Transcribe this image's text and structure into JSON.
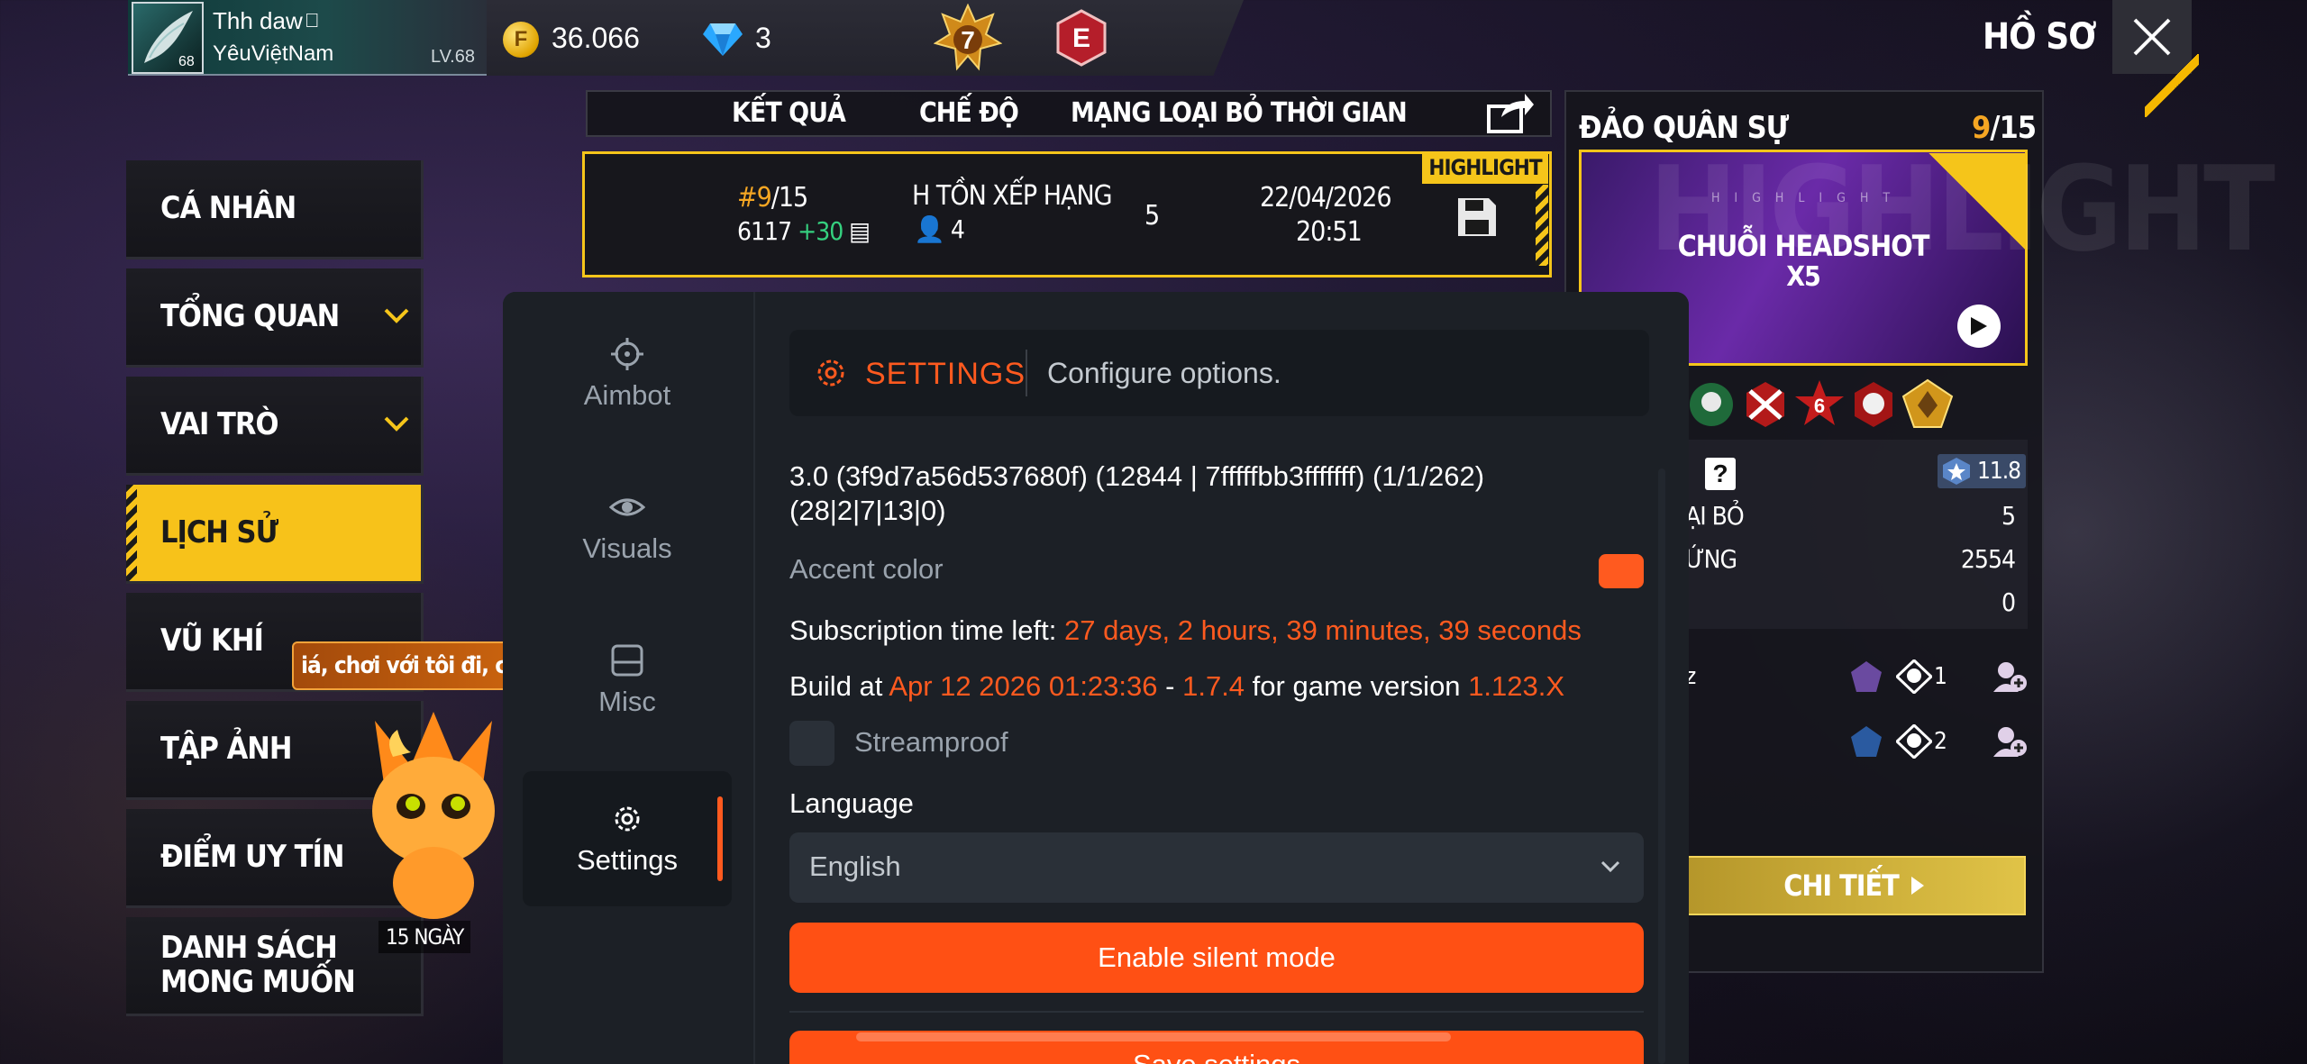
{
  "profile": {
    "name": "Thh daw",
    "tag": "YêuViệtNam",
    "avatar_level": "68",
    "level": "LV.68"
  },
  "currency": {
    "coins": "36.066",
    "coin_symbol": "F",
    "diamonds": "3"
  },
  "rank_badge_number": "7",
  "elite_badge_letter": "E",
  "header": {
    "title": "HỒ SƠ"
  },
  "menu": {
    "items": [
      {
        "label": "CÁ NHÂN"
      },
      {
        "label": "TỔNG QUAN"
      },
      {
        "label": "VAI TRÒ"
      },
      {
        "label": "LỊCH SỬ"
      },
      {
        "label": "VŨ KHÍ"
      },
      {
        "label": "TẬP ẢNH"
      },
      {
        "label": "ĐIỂM UY TÍN"
      },
      {
        "label": "DANH SÁCH",
        "label2": "MONG MUỐN"
      }
    ],
    "active_index": 3
  },
  "mascot": {
    "speech": "iá, chơi với tôi đi, c",
    "days": "15 NGÀY"
  },
  "match_table": {
    "columns": [
      "KẾT QUẢ",
      "CHẾ ĐỘ",
      "MẠNG LOẠI BỎ",
      "THỜI GIAN"
    ],
    "row": {
      "rank": "#9",
      "rank_total": "/15",
      "points": "6117",
      "points_gain": "+30",
      "mode": "H TỒN XẾP HẠNG",
      "team_size": "4",
      "kills": "5",
      "date": "22/04/2026",
      "time": "20:51",
      "highlight": "HIGHLIGHT"
    }
  },
  "right_panel": {
    "map_name": "ĐẢO QUÂN SỰ",
    "map_rank": "9",
    "map_rank_total": "/15",
    "card_bg_text": "HIGHLIGHT",
    "card_small_text": "H I G H L I G H T",
    "card_title": "CHUỖI HEADSHOT",
    "card_subtitle": "X5",
    "rating": "11.8",
    "stats": [
      {
        "label": "ẠI BỎ",
        "value": "5"
      },
      {
        "label": "ỨNG",
        "value": "2554"
      },
      {
        "label": "",
        "value": "0"
      }
    ],
    "teammates": [
      {
        "name": "z",
        "count": "1"
      },
      {
        "name": "",
        "count": "2"
      }
    ],
    "details_label": "CHI TIẾT"
  },
  "overlay": {
    "nav": [
      {
        "label": "Aimbot",
        "icon": "crosshair-icon"
      },
      {
        "label": "Visuals",
        "icon": "eye-icon"
      },
      {
        "label": "Misc",
        "icon": "inbox-icon"
      },
      {
        "label": "Settings",
        "icon": "gear-icon"
      }
    ],
    "active_nav": "Settings",
    "accent_color": "#ff5a1f",
    "section": {
      "title": "SETTINGS",
      "description": "Configure options."
    },
    "version_line1": "3.0 (3f9d7a56d537680f) (12844 | 7fffffbb3fffffff) (1/1/262)",
    "version_line2": "(28|2|7|13|0)",
    "accent_label": "Accent color",
    "subscription_label": "Subscription time left:",
    "subscription_value": "27 days, 2 hours, 39 minutes, 39 seconds",
    "build_label": "Build at",
    "build_date": "Apr 12 2026 01:23:36",
    "build_dash": "-",
    "build_version": "1.7.4",
    "build_for": "for game version",
    "game_version": "1.123.X",
    "streamproof_label": "Streamproof",
    "streamproof_checked": false,
    "language_label": "Language",
    "language_value": "English",
    "silent_button": "Enable silent mode",
    "save_button": "Save settings"
  }
}
